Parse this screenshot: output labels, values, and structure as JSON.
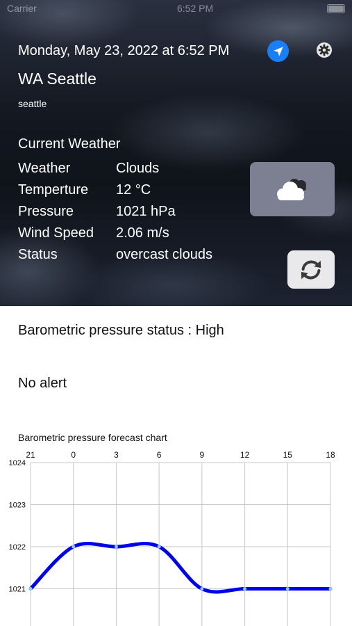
{
  "status_bar": {
    "carrier": "Carrier",
    "time": "6:52 PM"
  },
  "header": {
    "datetime": "Monday, May 23, 2022 at 6:52 PM",
    "location_icon": "location-arrow-icon",
    "settings_icon": "gear-icon",
    "accent_color": "#1a7ef7"
  },
  "city": {
    "title": "WA Seattle",
    "subtitle": "seattle"
  },
  "current": {
    "title": "Current Weather",
    "rows": [
      {
        "label": "Weather",
        "value": "Clouds"
      },
      {
        "label": "Temperture",
        "value": "12 °C"
      },
      {
        "label": "Pressure",
        "value": "1021 hPa"
      },
      {
        "label": "Wind Speed",
        "value": "2.06 m/s"
      },
      {
        "label": "Status",
        "value": "overcast clouds"
      }
    ],
    "condition_icon": "cloud-icon",
    "refresh_icon": "refresh-icon"
  },
  "pressure_status": "Barometric pressure status : High",
  "alert": "No alert",
  "chart_title": "Barometric pressure forecast chart",
  "chart_data": {
    "type": "line",
    "title": "Barometric pressure forecast chart",
    "x_tick_labels": [
      "21",
      "0",
      "3",
      "6",
      "9",
      "12",
      "15",
      "18"
    ],
    "y_tick_labels": [
      "1024",
      "1023",
      "1022",
      "1021"
    ],
    "ylim": [
      1020,
      1024
    ],
    "grid": true,
    "line_color": "#0000ee",
    "series": [
      {
        "x": [
          0,
          1,
          2,
          3,
          4,
          5,
          6,
          7
        ],
        "values": [
          1021,
          1022,
          1022,
          1022,
          1021,
          1021,
          1021,
          1021
        ]
      }
    ]
  }
}
